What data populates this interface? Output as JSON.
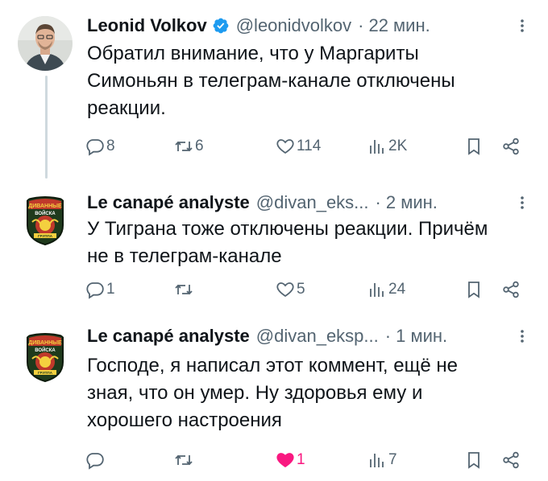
{
  "tweets": [
    {
      "name": "Leonid Volkov",
      "verified": true,
      "handle": "@leonidvolkov",
      "separator": "·",
      "time": "22 мин.",
      "text_lines": [
        "Обратил внимание, что у Маргариты",
        "Симоньян в телеграм-канале отключены",
        "реакции."
      ],
      "replies": "8",
      "retweets": "6",
      "likes": "114",
      "views": "2K",
      "avatar_icon": "person-photo-avatar"
    },
    {
      "name": "Le canapé analyste",
      "verified": false,
      "handle": "@divan_eks...",
      "separator": "·",
      "time": "2 мин.",
      "text_lines": [
        "У Тиграна тоже отключены реакции. Причём",
        "не в телеграм-канале"
      ],
      "replies": "1",
      "retweets": "",
      "likes": "5",
      "views": "24",
      "avatar_icon": "divan-troops-patch-avatar"
    },
    {
      "name": "Le canapé analyste",
      "verified": false,
      "handle": "@divan_eksp...",
      "separator": "·",
      "time": "1 мин.",
      "text_lines": [
        "Господе, я написал этот коммент, ещё не",
        "зная, что он умер. Ну здоровья ему и",
        "хорошего настроения"
      ],
      "replies": "",
      "retweets": "",
      "likes": "1",
      "liked": true,
      "views": "7",
      "avatar_icon": "divan-troops-patch-avatar"
    }
  ],
  "patch": {
    "top_text": "ДИВАННЫЕ",
    "middle_text": "ВОЙСКА",
    "bottom_text": "ГРУППА"
  },
  "colors": {
    "text": "#0f1419",
    "secondary": "#536471",
    "verified": "#1d9bf0",
    "like_active": "#f91880",
    "thread_line": "#cfd9de"
  }
}
